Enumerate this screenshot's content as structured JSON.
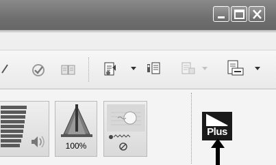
{
  "window": {
    "controls": {
      "minimize_icon": "minimize-icon",
      "maximize_icon": "maximize-icon",
      "close_icon": "close-icon"
    }
  },
  "toolbar": {
    "items": [
      {
        "name": "partial-arrow-icon"
      },
      {
        "name": "checkmark-icon"
      },
      {
        "name": "book-icon"
      },
      {
        "name": "document-icon"
      },
      {
        "name": "filing-icon"
      },
      {
        "name": "grayed-doc-icon"
      },
      {
        "name": "export-icon"
      }
    ]
  },
  "panel": {
    "volume_icon": "speaker-icon",
    "zoom": {
      "icon": "metronome-icon",
      "label": "100%"
    },
    "tempo_icon": "tempo-icon",
    "plus": {
      "label": "Plus",
      "icon": "play-plus-icon"
    }
  }
}
